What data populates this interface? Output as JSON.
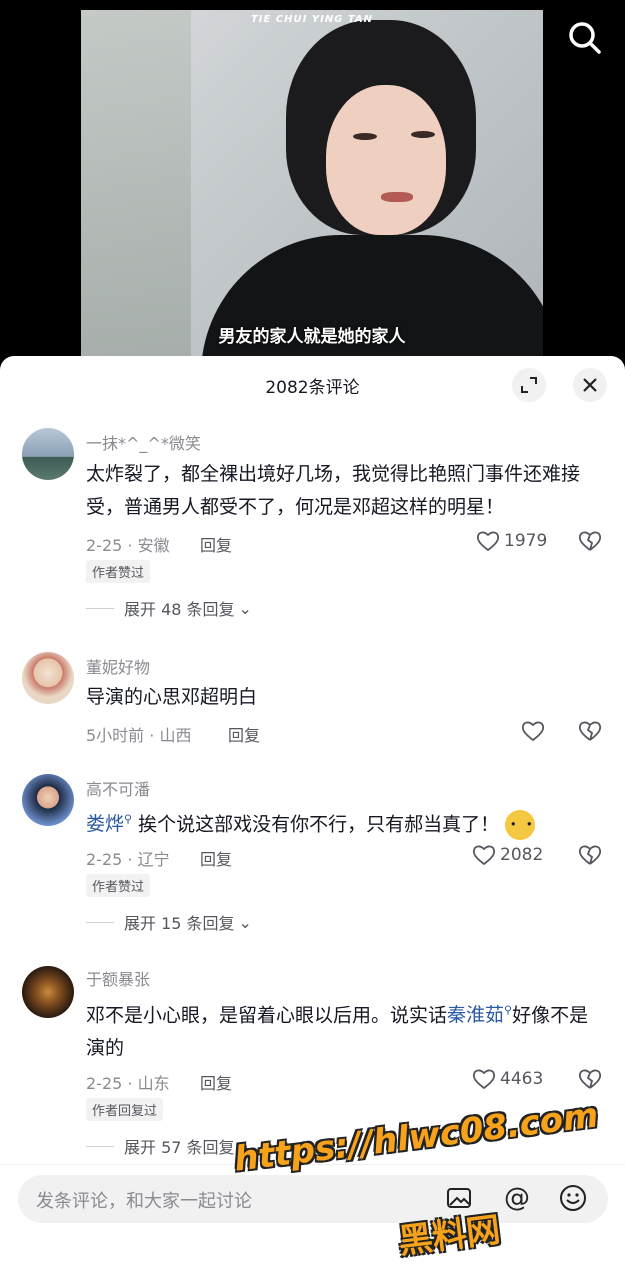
{
  "video": {
    "watermark": "TIE CHUI YING TAN",
    "subtitle": "男友的家人就是她的家人"
  },
  "sheet": {
    "title": "2082条评论"
  },
  "comments": [
    {
      "user": "一抹*^_^*微笑",
      "text": "太炸裂了，都全裸出境好几场，我觉得比艳照门事件还难接受，普通男人都受不了，何况是邓超这样的明星！",
      "date": "2-25 · 安徽",
      "reply": "回复",
      "likes": "1979",
      "badge": "作者赞过",
      "expand": "展开 48 条回复"
    },
    {
      "user": "董妮好物",
      "text": "导演的心思邓超明白",
      "date": "5小时前 · 山西",
      "reply": "回复"
    },
    {
      "user": "高不可潘",
      "mention": "娄烨",
      "text": "挨个说这部戏没有你不行，只有郝当真了！",
      "date": "2-25 · 辽宁",
      "reply": "回复",
      "likes": "2082",
      "badge": "作者赞过",
      "expand": "展开 15 条回复"
    },
    {
      "user": "于额暴张",
      "text_a": "邓不是小心眼，是留着心眼以后用。说实话",
      "mention": "秦淮茹",
      "text_b": "好像不是演的",
      "date": "2-25 · 山东",
      "reply": "回复",
      "likes": "4463",
      "badge": "作者回复过",
      "expand": "展开 57 条回复"
    }
  ],
  "input": {
    "placeholder": "发条评论，和大家一起讨论"
  },
  "overlay_watermark": {
    "line1": "https://hlwc08.com",
    "line2": "黑料网"
  },
  "icons": {
    "search": "search-icon",
    "expand": "expand-icon",
    "close": "close-icon",
    "like": "heart-icon",
    "dislike": "broken-heart-icon",
    "image": "image-icon",
    "at": "at-icon",
    "emoji": "emoji-icon"
  },
  "colors": {
    "mention": "#2b5aa3",
    "watermark": "#f7a21b"
  }
}
